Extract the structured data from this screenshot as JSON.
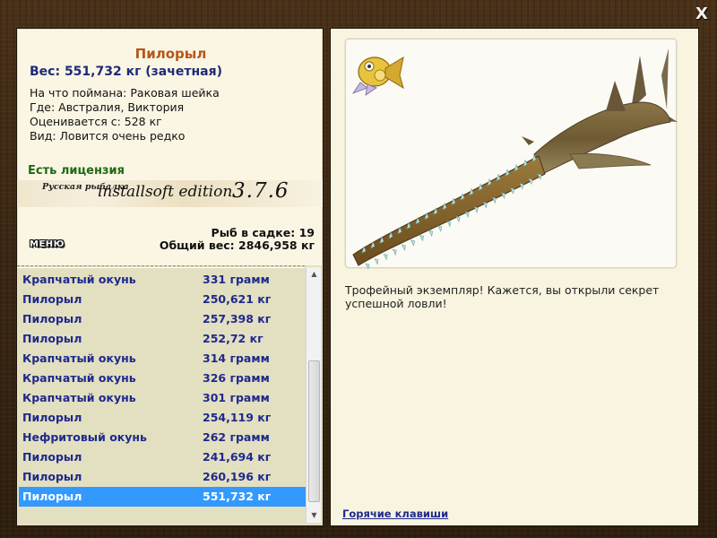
{
  "window": {
    "close_label": "X"
  },
  "catch_info": {
    "fish_name": "Пилорыл",
    "weight_title": "Вес: 551,732 кг (зачетная)",
    "lines": [
      "На что поймана: Раковая шейка",
      "Где: Австралия, Виктория",
      "Оценивается с: 528 кг",
      "Вид: Ловится очень редко"
    ],
    "license": "Есть лицензия"
  },
  "brand": {
    "small": "Русская рыбалка",
    "name": "installsoft edition",
    "version": "3.7.6"
  },
  "stats": {
    "fish_count": "Рыб в садке: 19",
    "total_weight": "Общий вес: 2846,958 кг"
  },
  "menu_button": "МЕНЮ",
  "catch_list": [
    {
      "name": "Крапчатый окунь",
      "weight": "331 грамм"
    },
    {
      "name": "Пилорыл",
      "weight": "250,621 кг"
    },
    {
      "name": "Пилорыл",
      "weight": "257,398 кг"
    },
    {
      "name": "Пилорыл",
      "weight": "252,72 кг"
    },
    {
      "name": "Крапчатый окунь",
      "weight": "314 грамм"
    },
    {
      "name": "Крапчатый окунь",
      "weight": "326 грамм"
    },
    {
      "name": "Крапчатый окунь",
      "weight": "301 грамм"
    },
    {
      "name": "Пилорыл",
      "weight": "254,119 кг"
    },
    {
      "name": "Нефритовый окунь",
      "weight": "262 грамм"
    },
    {
      "name": "Пилорыл",
      "weight": "241,694 кг"
    },
    {
      "name": "Пилорыл",
      "weight": "260,196 кг"
    },
    {
      "name": "Пилорыл",
      "weight": "551,732 кг"
    }
  ],
  "selected_index": 11,
  "description": "Трофейный экземпляр! Кажется, вы открыли секрет успешной ловли!",
  "hotkeys_link": "Горячие клавиши",
  "colors": {
    "title_accent": "#b8561a",
    "weight_blue": "#1f2a78",
    "license_green": "#1c6a14",
    "selection": "#3399ff"
  },
  "icons": [
    "trophy-badge-icon",
    "sawfish-image",
    "scroll-up-icon",
    "scroll-down-icon",
    "close-icon"
  ]
}
